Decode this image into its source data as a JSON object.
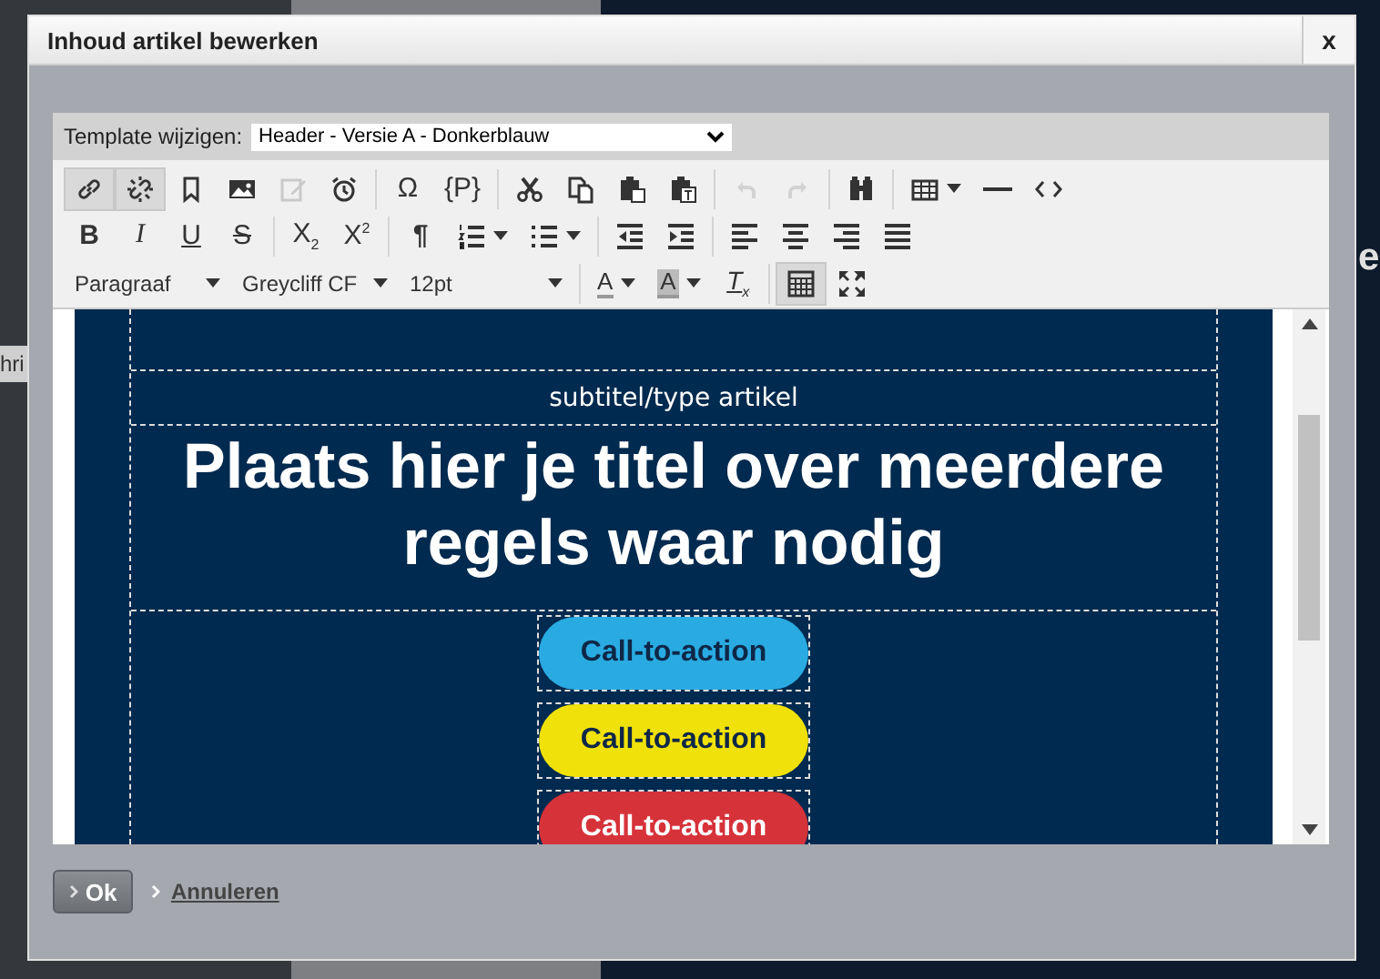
{
  "background": {
    "fragments": [
      {
        "kind": "left",
        "text": "hri"
      },
      {
        "kind": "right",
        "text": "e"
      }
    ]
  },
  "dialog": {
    "title": "Inhoud artikel bewerken",
    "close": "x"
  },
  "template": {
    "label": "Template wijzigen:",
    "value": "Header - Versie A - Donkerblauw"
  },
  "toolbar": {
    "rows": [
      {
        "groups": [
          {
            "buttons": [
              {
                "kind": "link",
                "active": true,
                "disabled": false
              },
              {
                "kind": "unlink",
                "active": true,
                "disabled": false
              },
              {
                "kind": "bookmark",
                "active": false,
                "disabled": false
              },
              {
                "kind": "image",
                "active": false,
                "disabled": false
              },
              {
                "kind": "edit-image",
                "active": false,
                "disabled": true
              },
              {
                "kind": "clock",
                "active": false,
                "disabled": false
              }
            ]
          },
          {
            "buttons": [
              {
                "kind": "glyph",
                "glyph": "Ω",
                "active": false,
                "disabled": false
              },
              {
                "kind": "glyph",
                "glyph": "{P}",
                "active": false,
                "disabled": false
              }
            ]
          },
          {
            "buttons": [
              {
                "kind": "cut",
                "active": false,
                "disabled": false
              },
              {
                "kind": "copy",
                "active": false,
                "disabled": false
              },
              {
                "kind": "paste",
                "active": false,
                "disabled": false
              },
              {
                "kind": "paste-text",
                "active": false,
                "disabled": false
              }
            ]
          },
          {
            "buttons": [
              {
                "kind": "undo",
                "active": false,
                "disabled": true
              },
              {
                "kind": "redo",
                "active": false,
                "disabled": true
              }
            ]
          },
          {
            "buttons": [
              {
                "kind": "find",
                "active": false,
                "disabled": false
              }
            ]
          },
          {
            "buttons": [
              {
                "kind": "table",
                "active": false,
                "disabled": false
              },
              {
                "kind": "hline",
                "active": false,
                "disabled": false
              },
              {
                "kind": "source",
                "active": false,
                "disabled": false
              }
            ]
          }
        ]
      },
      {
        "groups": [
          {
            "buttons": [
              {
                "kind": "bold",
                "glyph": "B",
                "active": false,
                "disabled": false
              },
              {
                "kind": "italic",
                "glyph": "I",
                "active": false,
                "disabled": false
              },
              {
                "kind": "underline",
                "glyph": "U",
                "active": false,
                "disabled": false
              },
              {
                "kind": "strike",
                "glyph": "S",
                "active": false,
                "disabled": false
              }
            ]
          },
          {
            "buttons": [
              {
                "kind": "glyph",
                "glyph": "X$_{2}$",
                "active": false,
                "disabled": false
              },
              {
                "kind": "glyph",
                "glyph": "X$^{2}$",
                "active": false,
                "disabled": false
              }
            ]
          },
          {
            "buttons": [
              {
                "kind": "pilcrow",
                "glyph": "¶",
                "active": false,
                "disabled": false
              },
              {
                "kind": "list-numbered",
                "active": false,
                "disabled": false
              },
              {
                "kind": "list-bulleted",
                "active": false,
                "disabled": false
              }
            ]
          },
          {
            "buttons": [
              {
                "kind": "outdent",
                "active": false,
                "disabled": false
              },
              {
                "kind": "indent",
                "active": false,
                "disabled": false
              }
            ]
          },
          {
            "buttons": [
              {
                "kind": "align-left",
                "active": false,
                "disabled": false
              },
              {
                "kind": "align-center",
                "active": false,
                "disabled": false
              },
              {
                "kind": "align-right",
                "active": false,
                "disabled": false
              },
              {
                "kind": "align-justify",
                "active": false,
                "disabled": false
              }
            ]
          }
        ]
      },
      {
        "groups": [
          {
            "buttons": [
              {
                "kind": "dropdown",
                "label": "Paragraaf"
              },
              {
                "kind": "dropdown",
                "label": "Greycliff CF"
              },
              {
                "kind": "dropdown",
                "label": "12pt"
              }
            ]
          },
          {
            "buttons": [
              {
                "kind": "text-color",
                "glyph": "A",
                "active": false,
                "disabled": false
              },
              {
                "kind": "bg-color",
                "glyph": "A",
                "active": false,
                "disabled": false
              },
              {
                "kind": "clear-format",
                "glyph": "T$_{x}$",
                "active": false,
                "disabled": false
              }
            ]
          },
          {
            "buttons": [
              {
                "kind": "show-blocks",
                "active": true,
                "disabled": false
              },
              {
                "kind": "fullscreen",
                "active": false,
                "disabled": false
              }
            ]
          }
        ]
      }
    ]
  },
  "content": {
    "subtitle": "subtitel/type artikel",
    "title": "Plaats hier je titel over meerdere regels waar nodig",
    "buttons": [
      {
        "label": "Call-to-action",
        "color": "#29abe2"
      },
      {
        "label": "Call-to-action",
        "color": "#f0e10a"
      },
      {
        "label": "Call-to-action",
        "color": "#d6323a"
      }
    ]
  },
  "footer": {
    "ok": "Ok",
    "cancel": "Annuleren"
  }
}
